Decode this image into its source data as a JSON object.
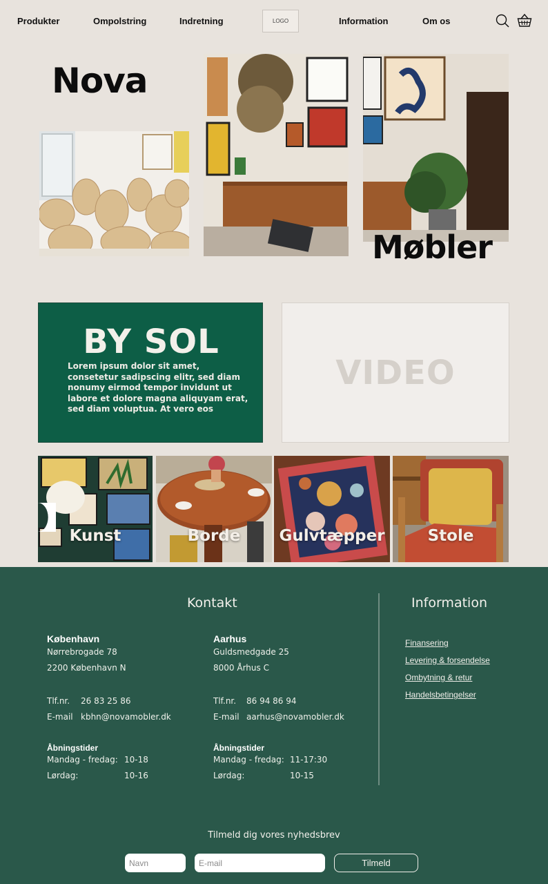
{
  "nav": {
    "items": [
      "Produkter",
      "Ompolstring",
      "Indretning",
      "Information",
      "Om os"
    ],
    "logo": "LOGO",
    "icons": [
      "search-icon",
      "basket-icon"
    ]
  },
  "hero": {
    "title_left": "Nova",
    "title_right": "Møbler"
  },
  "bysol": {
    "title": "BY SOL",
    "text": "Lorem ipsum dolor sit amet, consetetur sadipscing elitr, sed diam nonumy eirmod tempor invidunt ut labore et dolore magna aliquyam erat, sed diam voluptua. At vero eos"
  },
  "video": {
    "label": "VIDEO"
  },
  "categories": [
    {
      "label": "Kunst"
    },
    {
      "label": "Borde"
    },
    {
      "label": "Gulvtæpper"
    },
    {
      "label": "Stole"
    }
  ],
  "footer": {
    "contact_heading": "Kontakt",
    "info_heading": "Information",
    "stores": [
      {
        "city": "København",
        "street": "Nørrebrogade 78",
        "postal": "2200 København N",
        "phone_label": "Tlf.nr.",
        "phone": "26 83 25 86",
        "email_label": "E-mail",
        "email": "kbhn@novamobler.dk",
        "hours_title": "Åbningstider",
        "weekday_label": "Mandag - fredag:",
        "weekday_hours": "10-18",
        "saturday_label": "Lørdag:",
        "saturday_hours": "10-16"
      },
      {
        "city": "Aarhus",
        "street": "Guldsmedgade 25",
        "postal": "8000 Århus C",
        "phone_label": "Tlf.nr.",
        "phone": "86 94 86 94",
        "email_label": "E-mail",
        "email": "aarhus@novamobler.dk",
        "hours_title": "Åbningstider",
        "weekday_label": "Mandag - fredag:",
        "weekday_hours": "11-17:30",
        "saturday_label": "Lørdag:",
        "saturday_hours": "10-15"
      }
    ],
    "info_links": [
      "Finansering",
      "Levering & forsendelse",
      "Ombytning & retur",
      "Handelsbetingelser"
    ],
    "newsletter": {
      "title": "Tilmeld dig vores nyhedsbrev",
      "name_placeholder": "Navn",
      "email_placeholder": "E-mail",
      "button": "Tilmeld"
    }
  },
  "colors": {
    "background": "#e8e3dd",
    "accent_green": "#0d5e46",
    "footer_green": "#2a584a"
  }
}
